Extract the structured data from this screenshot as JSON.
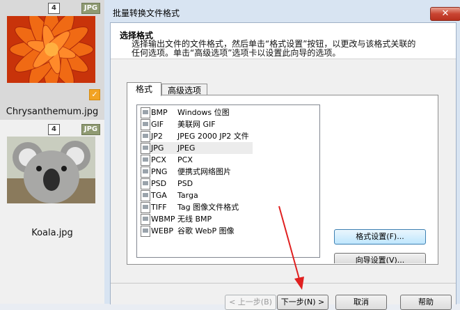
{
  "thumbnails": [
    {
      "count": "4",
      "format": "JPG",
      "name": "Chrysanthemum.jpg",
      "checked": true
    },
    {
      "count": "4",
      "format": "JPG",
      "name": "Koala.jpg",
      "checked": false
    }
  ],
  "dialog": {
    "title": "批量转换文件格式",
    "close_label": "✕",
    "header_title": "选择格式",
    "header_desc": "选择输出文件的文件格式，然后单击“格式设置”按钮，以更改与该格式关联的任何选项。单击“高级选项”选项卡以设置此向导的选项。",
    "tabs": [
      {
        "label": "格式"
      },
      {
        "label": "高级选项"
      }
    ],
    "formats": [
      {
        "code": "BMP",
        "desc": "Windows 位图"
      },
      {
        "code": "GIF",
        "desc": "美联网 GIF"
      },
      {
        "code": "JP2",
        "desc": "JPEG 2000 JP2 文件"
      },
      {
        "code": "JPG",
        "desc": "JPEG"
      },
      {
        "code": "PCX",
        "desc": "PCX"
      },
      {
        "code": "PNG",
        "desc": "便携式网络图片"
      },
      {
        "code": "PSD",
        "desc": "PSD"
      },
      {
        "code": "TGA",
        "desc": "Targa"
      },
      {
        "code": "TIFF",
        "desc": "Tag 图像文件格式"
      },
      {
        "code": "WBMP",
        "desc": "无线 BMP"
      },
      {
        "code": "WEBP",
        "desc": "谷歌 WebP 图像"
      }
    ],
    "selected_format": "JPG",
    "format_settings_label": "格式设置(F)...",
    "wizard_settings_label": "向导设置(V)...",
    "back_label": "< 上一步(B)",
    "next_label": "下一步(N) >",
    "cancel_label": "取消",
    "help_label": "帮助"
  },
  "colors": {
    "accent": "#3c7fb1",
    "arrow": "#e02020",
    "badge": "#8f9a72",
    "check": "#f2a324"
  }
}
